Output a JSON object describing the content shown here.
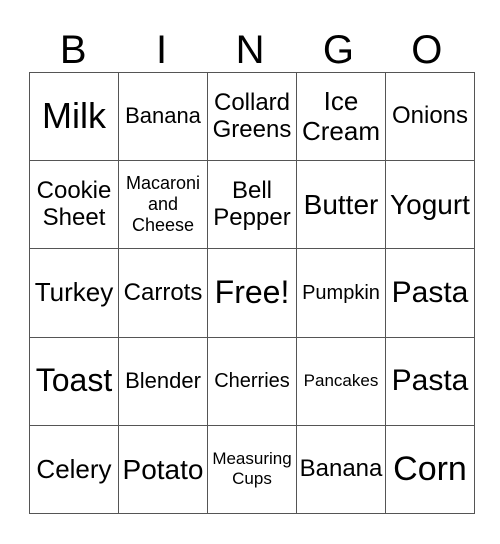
{
  "header": [
    "B",
    "I",
    "N",
    "G",
    "O"
  ],
  "rows": [
    [
      {
        "text": "Milk",
        "size": 36
      },
      {
        "text": "Banana",
        "size": 22
      },
      {
        "text": "Collard Greens",
        "size": 24
      },
      {
        "text": "Ice Cream",
        "size": 26
      },
      {
        "text": "Onions",
        "size": 24
      }
    ],
    [
      {
        "text": "Cookie Sheet",
        "size": 24
      },
      {
        "text": "Macaroni and Cheese",
        "size": 18
      },
      {
        "text": "Bell Pepper",
        "size": 24
      },
      {
        "text": "Butter",
        "size": 28
      },
      {
        "text": "Yogurt",
        "size": 28
      }
    ],
    [
      {
        "text": "Turkey",
        "size": 26
      },
      {
        "text": "Carrots",
        "size": 24
      },
      {
        "text": "Free!",
        "size": 32
      },
      {
        "text": "Pumpkin",
        "size": 20
      },
      {
        "text": "Pasta",
        "size": 30
      }
    ],
    [
      {
        "text": "Toast",
        "size": 32
      },
      {
        "text": "Blender",
        "size": 22
      },
      {
        "text": "Cherries",
        "size": 20
      },
      {
        "text": "Pancakes",
        "size": 17
      },
      {
        "text": "Pasta",
        "size": 30
      }
    ],
    [
      {
        "text": "Celery",
        "size": 26
      },
      {
        "text": "Potato",
        "size": 28
      },
      {
        "text": "Measuring Cups",
        "size": 17
      },
      {
        "text": "Banana",
        "size": 24
      },
      {
        "text": "Corn",
        "size": 34
      }
    ]
  ]
}
